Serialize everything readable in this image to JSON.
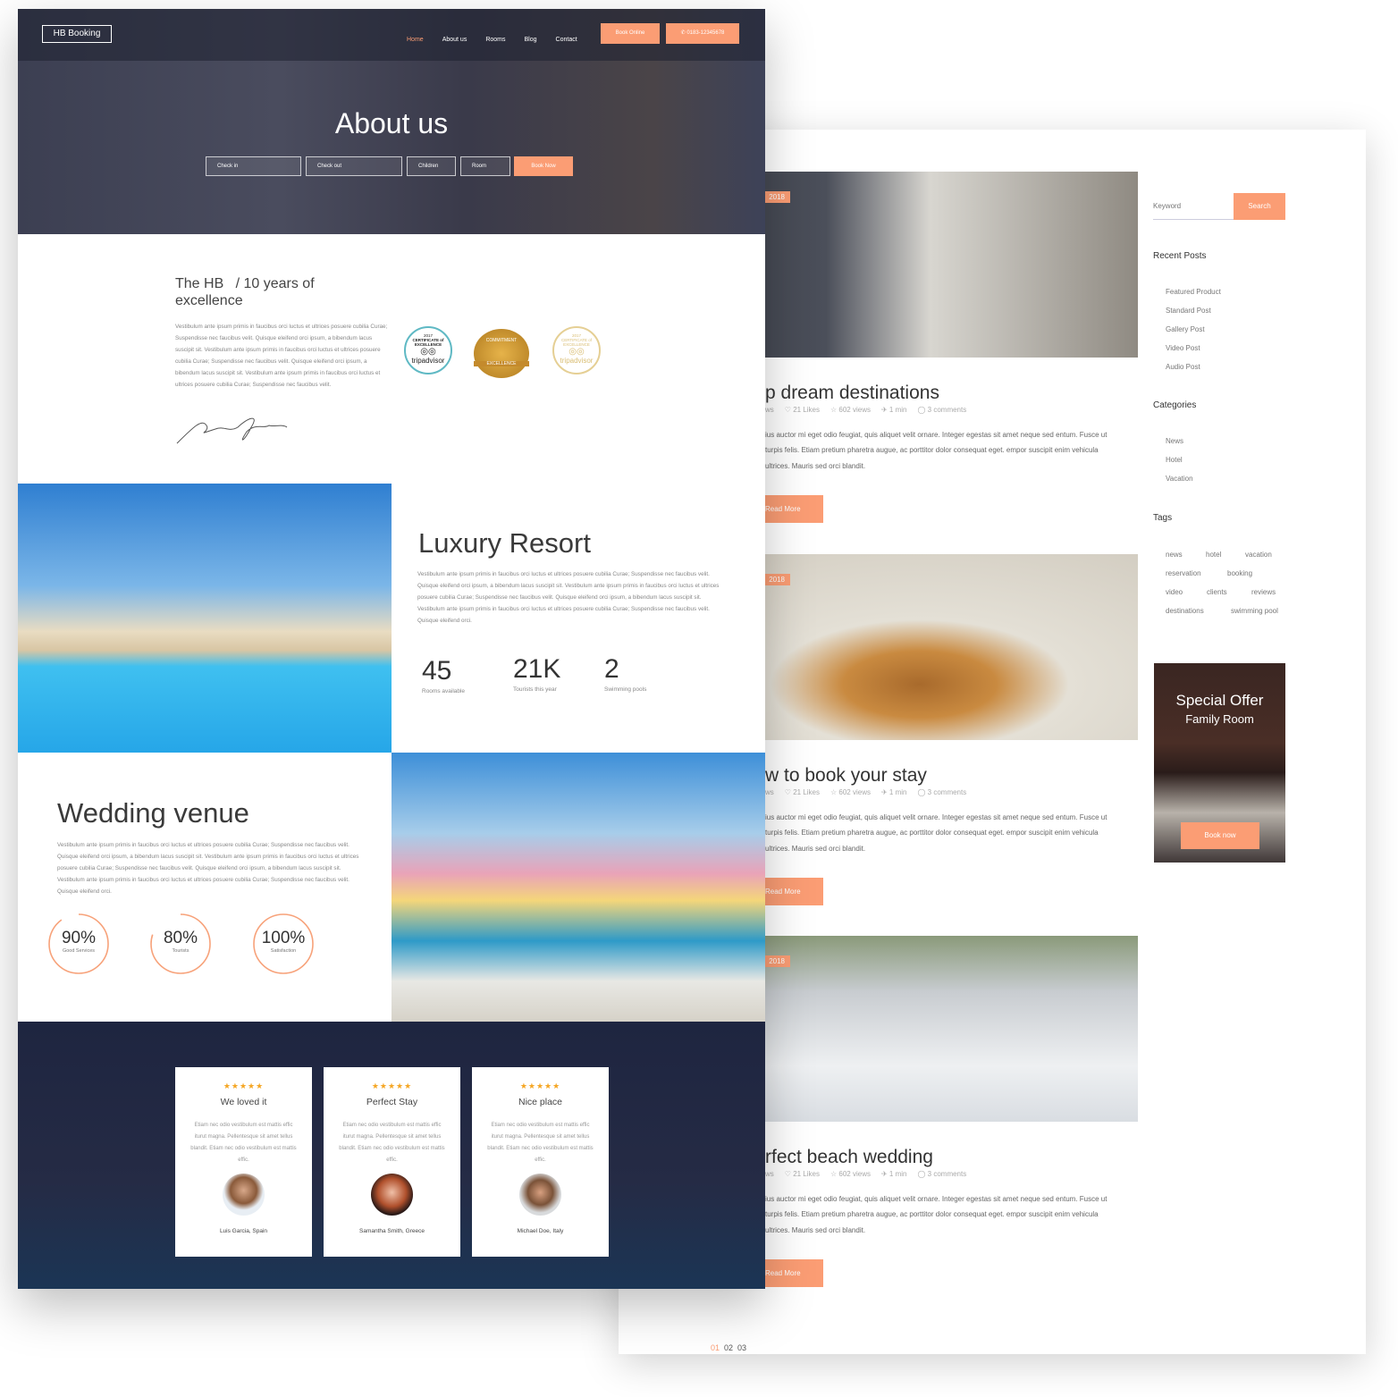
{
  "accent": "#fb9d74",
  "blog": {
    "posts": [
      {
        "date": "2018",
        "title": "p dream destinations",
        "meta": {
          "category": "ws",
          "likes": "21 Likes",
          "views": "602 views",
          "read": "1 min",
          "comments": "3 comments"
        },
        "text": "ius auctor mi eget odio feugiat, quis aliquet velit ornare. Integer egestas sit amet neque sed entum. Fusce ut turpis felis. Etiam pretium pharetra augue, ac porttitor dolor consequat eget. empor suscipit enim vehicula ultrices. Mauris sed orci blandit.",
        "button": "Read More"
      },
      {
        "date": "2018",
        "title": "w to book your stay",
        "meta": {
          "category": "ws",
          "likes": "21 Likes",
          "views": "602 views",
          "read": "1 min",
          "comments": "3 comments"
        },
        "text": "ius auctor mi eget odio feugiat, quis aliquet velit ornare. Integer egestas sit amet neque sed entum. Fusce ut turpis felis. Etiam pretium pharetra augue, ac porttitor dolor consequat eget. empor suscipit enim vehicula ultrices. Mauris sed orci blandit.",
        "button": "Read More"
      },
      {
        "date": "2018",
        "title": "rfect beach wedding",
        "meta": {
          "category": "ws",
          "likes": "21 Likes",
          "views": "602 views",
          "read": "1 min",
          "comments": "3 comments"
        },
        "text": "ius auctor mi eget odio feugiat, quis aliquet velit ornare. Integer egestas sit amet neque sed entum. Fusce ut turpis felis. Etiam pretium pharetra augue, ac porttitor dolor consequat eget. empor suscipit enim vehicula ultrices. Mauris sed orci blandit.",
        "button": "Read More"
      }
    ],
    "pagination": [
      "01",
      "02",
      "03"
    ],
    "sidebar": {
      "search_placeholder": "Keyword",
      "search_button": "Search",
      "recent_title": "Recent Posts",
      "recent": [
        "Featured Product",
        "Standard Post",
        "Gallery Post",
        "Video Post",
        "Audio Post"
      ],
      "categories_title": "Categories",
      "categories": [
        "News",
        "Hotel",
        "Vacation"
      ],
      "tags_title": "Tags",
      "tags": [
        "news",
        "hotel",
        "vacation",
        "reservation",
        "booking",
        "video",
        "clients",
        "reviews",
        "destinations",
        "swimming pool"
      ],
      "offer": {
        "title": "Special Offer",
        "subtitle": "Family Room",
        "button": "Book now"
      }
    }
  },
  "site": {
    "logo": "HB Booking",
    "nav": [
      "Home",
      "About us",
      "Rooms",
      "Blog",
      "Contact"
    ],
    "book_online": "Book Online",
    "phone": "0183-12345678",
    "hero": {
      "title": "About us",
      "fields": [
        "Check in",
        "Check out",
        "Children",
        "Room"
      ],
      "button": "Book Now"
    },
    "about": {
      "title_a": "The HB",
      "title_b": "/ 10 years of",
      "title_c": "excellence",
      "text": "Vestibulum ante ipsum primis in faucibus orci luctus et ultrices posuere cubilia Curae; Suspendisse nec faucibus velit. Quisque eleifend orci ipsum, a bibendum lacus suscipit sit. Vestibulum ante ipsum primis in faucibus orci luctus et ultrices posuere cubilia Curae; Suspendisse nec faucibus velit. Quisque eleifend orci ipsum, a bibendum lacus suscipit sit. Vestibulum ante ipsum primis in faucibus orci luctus et ultrices posuere cubilia Curae; Suspendisse nec faucibus velit.",
      "badges": [
        {
          "year": "2017",
          "label": "CERTIFICATE of EXCELLENCE",
          "brand": "tripadvisor"
        },
        {
          "top": "COMMITMENT",
          "ribbon": "EXCELLENCE"
        },
        {
          "year": "2017",
          "label": "CERTIFICATE of EXCELLENCE",
          "brand": "tripadvisor"
        }
      ]
    },
    "luxury": {
      "title": "Luxury Resort",
      "text": "Vestibulum ante ipsum primis in faucibus orci luctus et ultrices posuere cubilia Curae; Suspendisse nec faucibus velit. Quisque eleifend orci ipsum, a bibendum lacus suscipit sit. Vestibulum ante ipsum primis in faucibus orci luctus et ultrices posuere cubilia Curae; Suspendisse nec faucibus velit. Quisque eleifend orci ipsum, a bibendum lacus suscipit sit. Vestibulum ante ipsum primis in faucibus orci luctus et ultrices posuere cubilia Curae; Suspendisse nec faucibus velit. Quisque eleifend orci.",
      "stats": [
        {
          "value": "45",
          "label": "Rooms available"
        },
        {
          "value": "21K",
          "label": "Tourists this year"
        },
        {
          "value": "2",
          "label": "Swimming pools"
        }
      ]
    },
    "wedding": {
      "title": "Wedding venue",
      "text": "Vestibulum ante ipsum primis in faucibus orci luctus et ultrices posuere cubilia Curae; Suspendisse nec faucibus velit. Quisque eleifend orci ipsum, a bibendum lacus suscipit sit. Vestibulum ante ipsum primis in faucibus orci luctus et ultrices posuere cubilia Curae; Suspendisse nec faucibus velit. Quisque eleifend orci ipsum, a bibendum lacus suscipit sit. Vestibulum ante ipsum primis in faucibus orci luctus et ultrices posuere cubilia Curae; Suspendisse nec faucibus velit. Quisque eleifend orci.",
      "rings": [
        {
          "value": "90%",
          "label": "Good Services",
          "percent": 90
        },
        {
          "value": "80%",
          "label": "Tourists",
          "percent": 80
        },
        {
          "value": "100%",
          "label": "Satisfaction",
          "percent": 100
        }
      ]
    },
    "testimonials": [
      {
        "stars": "★★★★★",
        "title": "We loved it",
        "text": "Etiam nec odio vestibulum est mattis effic iturut magna. Pellentesque sit amet tellus blandit. Etiam nec odio vestibulum est mattis effic.",
        "name": "Luis Garcia, Spain"
      },
      {
        "stars": "★★★★★",
        "title": "Perfect Stay",
        "text": "Etiam nec odio vestibulum est mattis effic iturut magna. Pellentesque sit amet tellus blandit. Etiam nec odio vestibulum est mattis effic.",
        "name": "Samantha Smith, Greece"
      },
      {
        "stars": "★★★★★",
        "title": "Nice place",
        "text": "Etiam nec odio vestibulum est mattis effic iturut magna. Pellentesque sit amet tellus blandit. Etiam nec odio vestibulum est mattis effic.",
        "name": "Michael Doe, Italy"
      }
    ]
  }
}
